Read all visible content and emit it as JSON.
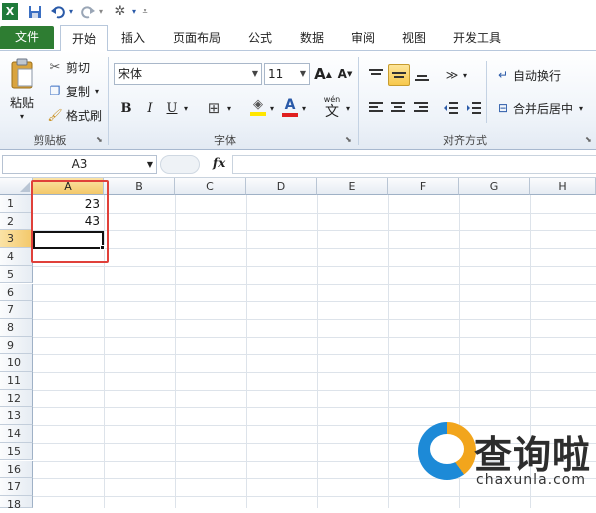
{
  "quick_access": {
    "app_icon": "excel-icon",
    "save_icon": "save-icon",
    "undo_icon": "undo-icon",
    "redo_icon": "redo-icon",
    "extra_icon": "tools-icon"
  },
  "tabs": [
    {
      "label": "文件"
    },
    {
      "label": "开始"
    },
    {
      "label": "插入"
    },
    {
      "label": "页面布局"
    },
    {
      "label": "公式"
    },
    {
      "label": "数据"
    },
    {
      "label": "审阅"
    },
    {
      "label": "视图"
    },
    {
      "label": "开发工具"
    }
  ],
  "clipboard": {
    "paste_label": "粘贴",
    "cut_label": "剪切",
    "copy_label": "复制",
    "format_painter_label": "格式刷",
    "group_label": "剪贴板"
  },
  "font": {
    "font_name": "宋体",
    "font_size": "11",
    "bold": "B",
    "italic": "I",
    "underline": "U",
    "group_label": "字体",
    "accent_fill": "#ffe600",
    "accent_font": "#e02020"
  },
  "alignment": {
    "wrap_label": "自动换行",
    "merge_label": "合并后居中",
    "group_label": "对齐方式"
  },
  "formula_bar": {
    "name_box": "A3",
    "fx": "fx"
  },
  "sheet": {
    "columns": [
      "A",
      "B",
      "C",
      "D",
      "E",
      "F",
      "G",
      "H"
    ],
    "rows": [
      "1",
      "2",
      "3",
      "4",
      "5",
      "6",
      "7",
      "8",
      "9",
      "10",
      "11",
      "12",
      "13",
      "14",
      "15",
      "16",
      "17",
      "18"
    ],
    "cells": {
      "A1": "23",
      "A2": "43"
    },
    "active_cell": "A3",
    "highlight_color": "#e0403a"
  },
  "watermark": {
    "text": "查询啦",
    "url": "chaxunla.com"
  }
}
